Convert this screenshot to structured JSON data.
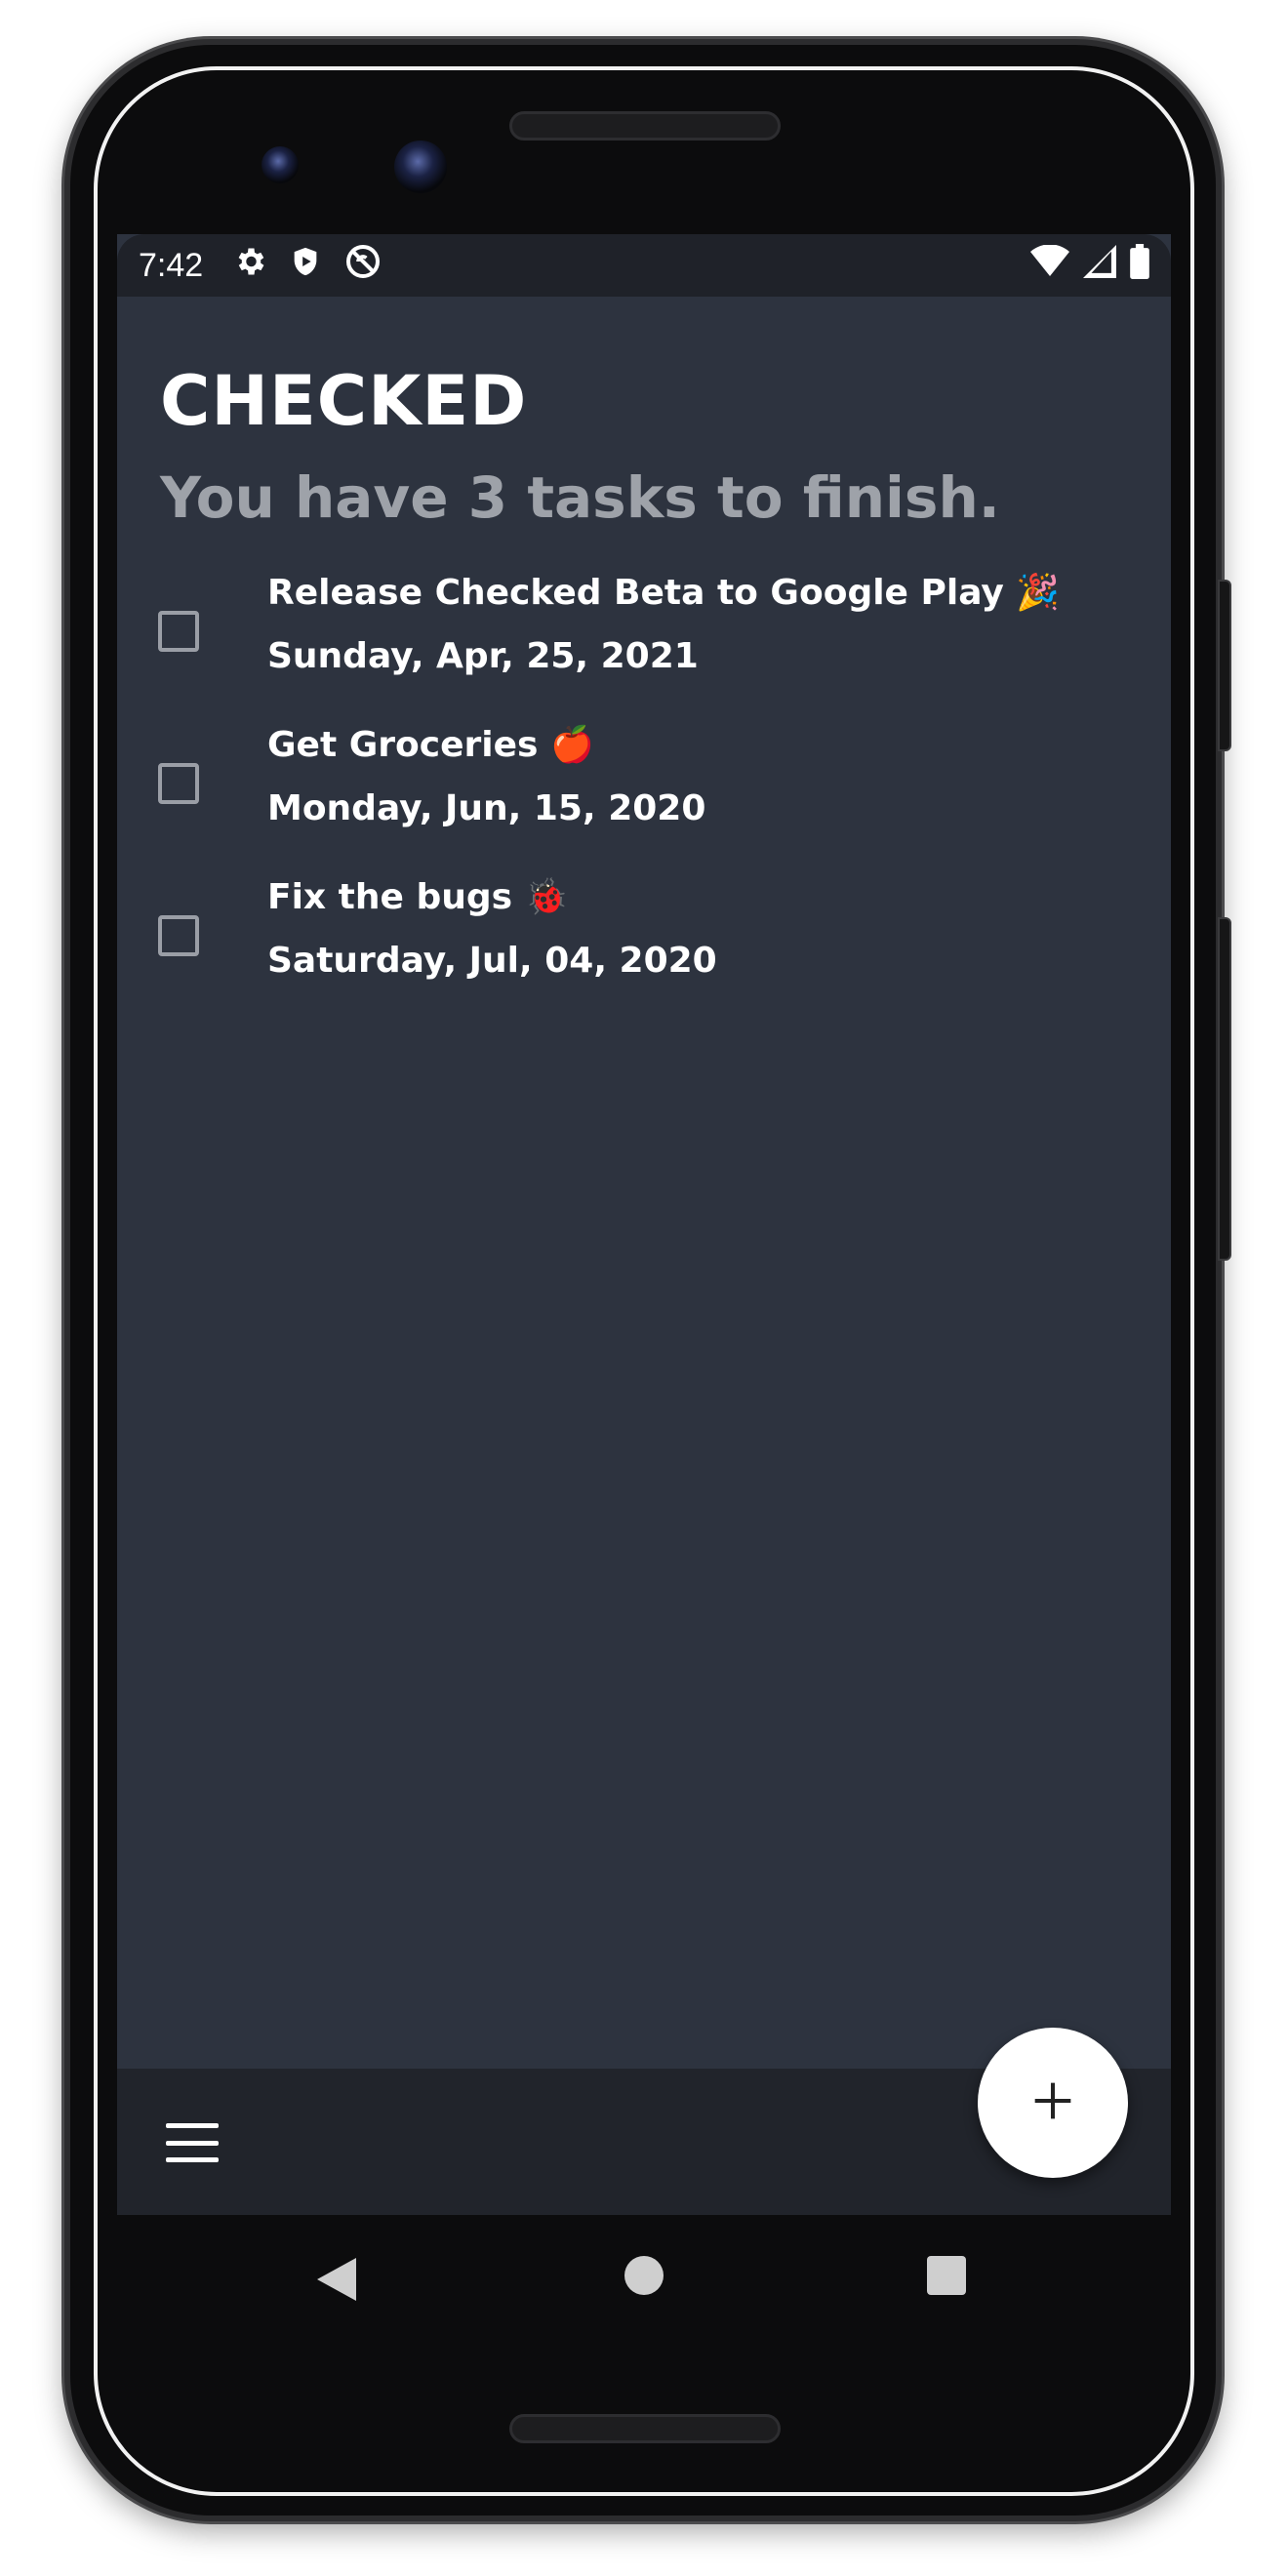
{
  "status_bar": {
    "time": "7:42",
    "left_icons": [
      "gear-icon",
      "shield-icon",
      "no-sync-icon"
    ],
    "right_icons": [
      "wifi-icon",
      "cell-signal-icon",
      "battery-icon"
    ]
  },
  "app": {
    "title": "CHECKED",
    "subtitle": "You have 3 tasks to finish."
  },
  "tasks": [
    {
      "title": "Release Checked Beta to Google Play 🎉",
      "date": "Sunday, Apr, 25, 2021",
      "checked": false
    },
    {
      "title": "Get Groceries 🍎",
      "date": "Monday, Jun, 15, 2020",
      "checked": false
    },
    {
      "title": "Fix the bugs 🐞",
      "date": "Saturday, Jul, 04, 2020",
      "checked": false
    }
  ],
  "bottom_bar": {
    "menu_icon": "hamburger-menu-icon",
    "fab_icon": "plus-icon"
  },
  "navigation": {
    "icons": [
      "back-icon",
      "home-icon",
      "recents-icon"
    ]
  },
  "colors": {
    "background": "#2d333f",
    "status_bar": "#1f2229",
    "bottom_bar": "#21242b",
    "subtitle": "#9ea2a9",
    "fab": "#ffffff"
  }
}
